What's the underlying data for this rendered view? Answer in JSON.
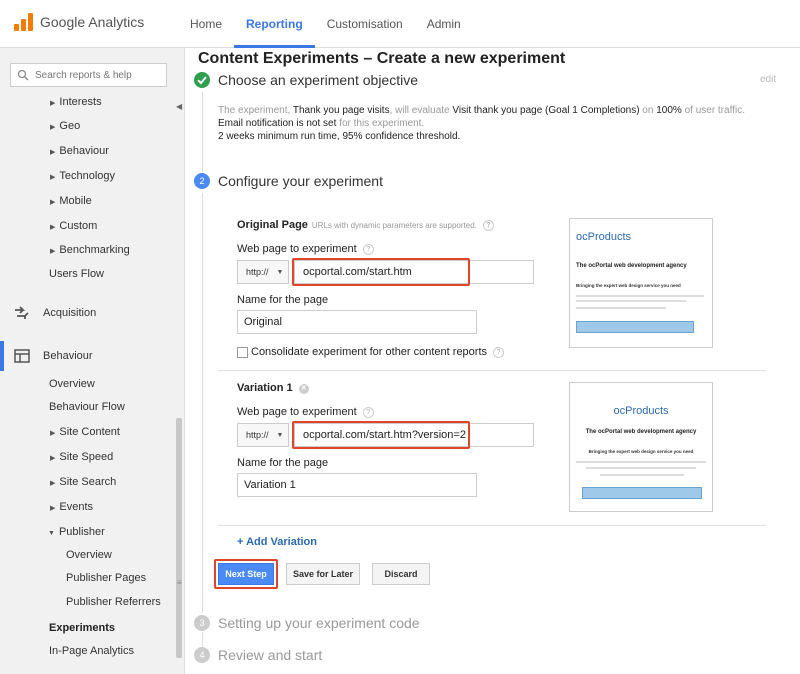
{
  "brand": {
    "name": "Google Analytics",
    "accent": "#3b78e7",
    "logo_color": "#f57c00"
  },
  "nav": {
    "items": [
      {
        "label": "Home"
      },
      {
        "label": "Reporting",
        "active": true
      },
      {
        "label": "Customisation"
      },
      {
        "label": "Admin"
      }
    ]
  },
  "sidebar": {
    "search_placeholder": "Search reports & help",
    "audience_items": [
      "Interests",
      "Geo",
      "Behaviour",
      "Technology",
      "Mobile",
      "Custom",
      "Benchmarking"
    ],
    "users_flow": "Users Flow",
    "acquisition": "Acquisition",
    "behaviour": "Behaviour",
    "behaviour_items": {
      "overview": "Overview",
      "flow": "Behaviour Flow",
      "site_content": "Site Content",
      "site_speed": "Site Speed",
      "site_search": "Site Search",
      "events": "Events",
      "publisher": "Publisher",
      "pub_overview": "Overview",
      "pub_pages": "Publisher Pages",
      "pub_referrers": "Publisher Referrers"
    },
    "experiments": "Experiments",
    "in_page": "In-Page Analytics"
  },
  "main": {
    "title": "Content Experiments – Create a new experiment",
    "step1": {
      "title": "Choose an experiment objective",
      "edit": "edit",
      "summary": {
        "t1": "The experiment, ",
        "name": "Thank you page visits",
        "t2": ", will evaluate ",
        "goal": "Visit thank you page (Goal 1 Completions)",
        "t3": " on ",
        "pct": "100%",
        "t4": " of user traffic.",
        "email": "Email notification is not set",
        "t5": " for this experiment.",
        "line3": "2 weeks minimum run time, 95% confidence threshold."
      }
    },
    "step2": {
      "number": "2",
      "title": "Configure your experiment",
      "original": {
        "heading": "Original Page",
        "note": "URLs with dynamic parameters are supported.",
        "url_label": "Web page to experiment",
        "protocol": "http://",
        "url": "ocportal.com/start.htm",
        "name_label": "Name for the page",
        "name": "Original",
        "consolidate": "Consolidate experiment for other content reports"
      },
      "variation": {
        "heading": "Variation 1",
        "url_label": "Web page to experiment",
        "protocol": "http://",
        "url": "ocportal.com/start.htm?version=2",
        "name_label": "Name for the page",
        "name": "Variation 1"
      },
      "thumb": {
        "brand": "ocProducts",
        "headline": "The ocPortal web development agency",
        "sub": "Bringing the expert web design service you need"
      },
      "add_variation": "+ Add Variation"
    },
    "buttons": {
      "next": "Next Step",
      "save": "Save for Later",
      "discard": "Discard"
    },
    "step3": {
      "number": "3",
      "title": "Setting up your experiment code"
    },
    "step4": {
      "number": "4",
      "title": "Review and start"
    }
  }
}
